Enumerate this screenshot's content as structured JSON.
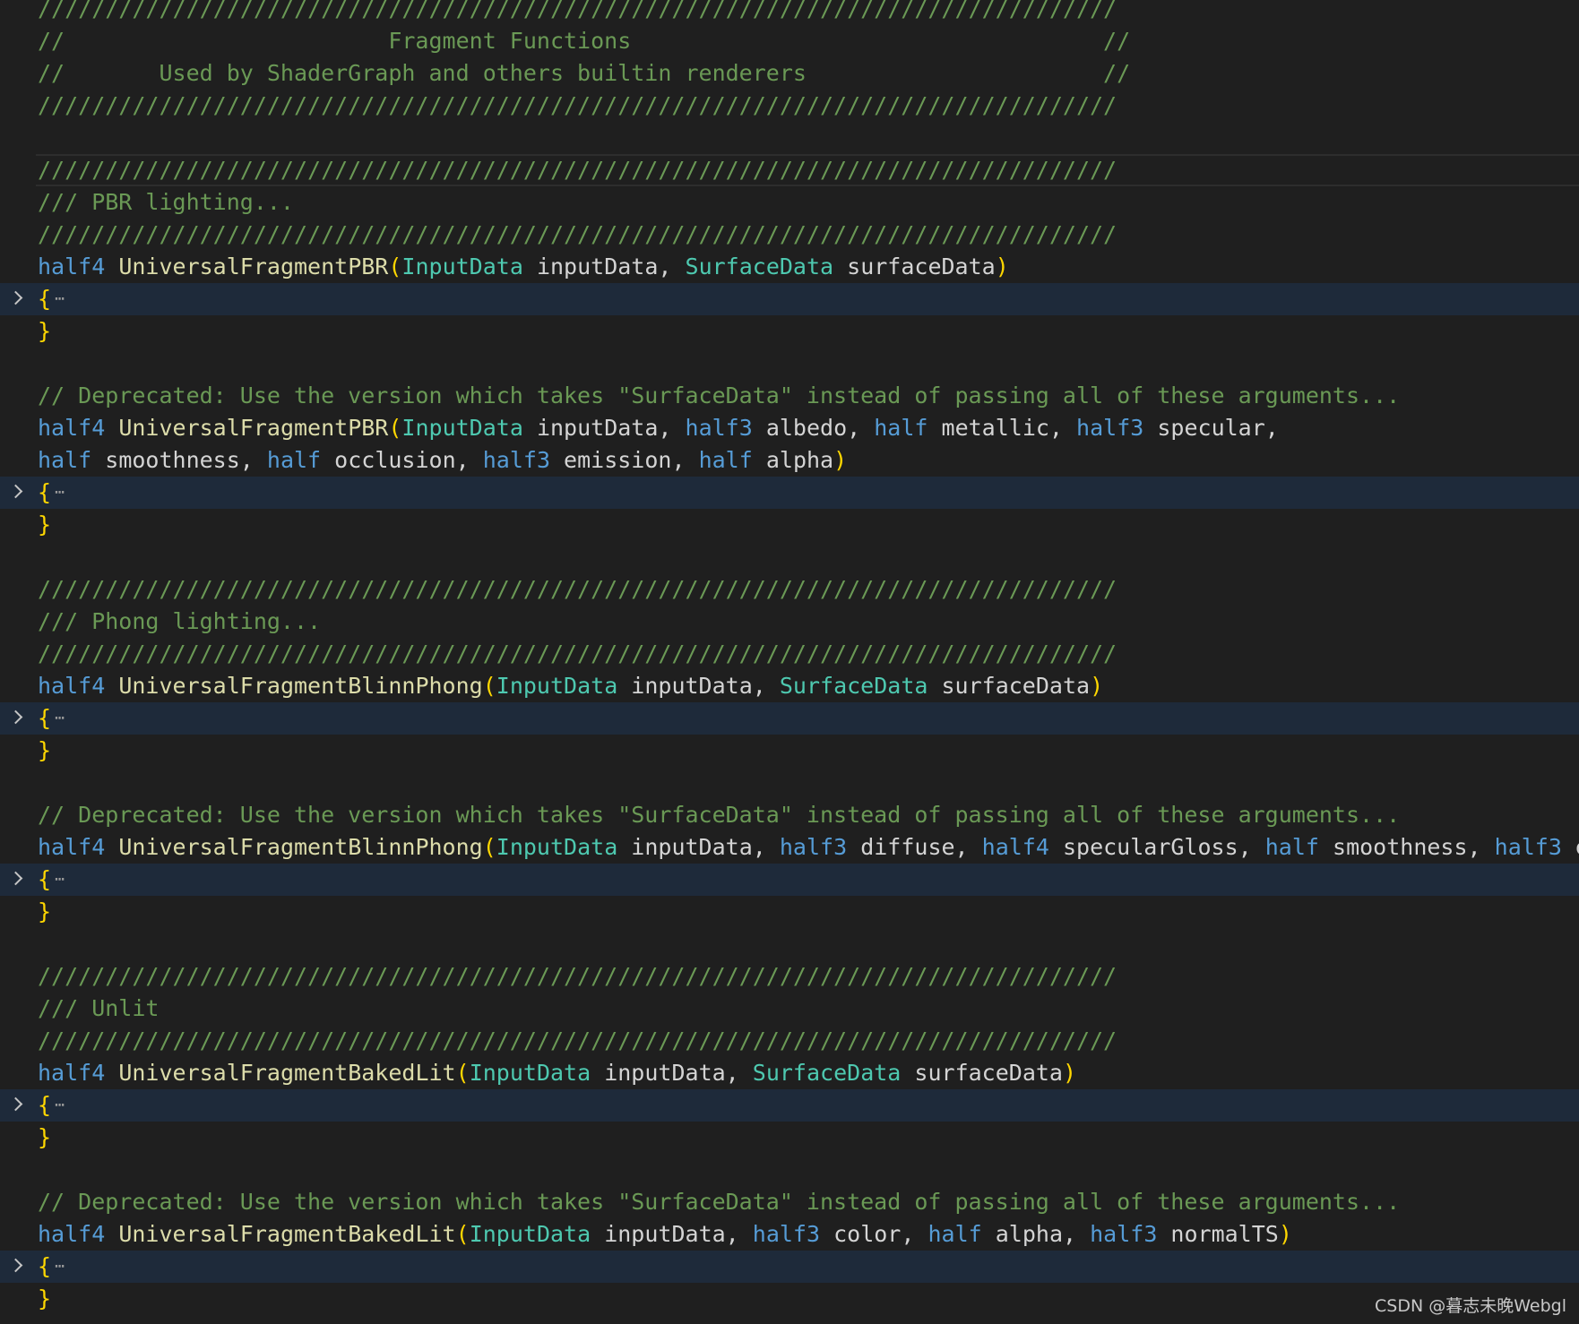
{
  "editor": {
    "lines": [
      {
        "segments": [
          {
            "t": "////////////////////////////////////////////////////////////////////////////////",
            "c": "cm"
          }
        ]
      },
      {
        "segments": [
          {
            "t": "//                        Fragment Functions                                   //",
            "c": "cm"
          }
        ]
      },
      {
        "segments": [
          {
            "t": "//       Used by ShaderGraph and others builtin renderers                      //",
            "c": "cm"
          }
        ]
      },
      {
        "segments": [
          {
            "t": "////////////////////////////////////////////////////////////////////////////////",
            "c": "cm"
          }
        ]
      },
      {
        "segments": []
      },
      {
        "current": true,
        "segments": [
          {
            "t": "////////////////////////////////////////////////////////////////////////////////",
            "c": "cm"
          }
        ]
      },
      {
        "segments": [
          {
            "t": "/// PBR lighting...",
            "c": "cm"
          }
        ]
      },
      {
        "segments": [
          {
            "t": "////////////////////////////////////////////////////////////////////////////////",
            "c": "cm"
          }
        ]
      },
      {
        "segments": [
          {
            "t": "half4",
            "c": "kw"
          },
          {
            "t": " ",
            "c": "id"
          },
          {
            "t": "UniversalFragmentPBR",
            "c": "fn"
          },
          {
            "t": "(",
            "c": "br"
          },
          {
            "t": "InputData",
            "c": "ty"
          },
          {
            "t": " inputData, ",
            "c": "id"
          },
          {
            "t": "SurfaceData",
            "c": "ty"
          },
          {
            "t": " surfaceData",
            "c": "id"
          },
          {
            "t": ")",
            "c": "br"
          }
        ]
      },
      {
        "folded": true,
        "segments": [
          {
            "t": "{",
            "c": "br"
          }
        ]
      },
      {
        "segments": [
          {
            "t": "}",
            "c": "br"
          }
        ]
      },
      {
        "segments": []
      },
      {
        "segments": [
          {
            "t": "// Deprecated: Use the version which takes \"SurfaceData\" instead of passing all of these arguments...",
            "c": "cm"
          }
        ]
      },
      {
        "segments": [
          {
            "t": "half4",
            "c": "kw"
          },
          {
            "t": " ",
            "c": "id"
          },
          {
            "t": "UniversalFragmentPBR",
            "c": "fn"
          },
          {
            "t": "(",
            "c": "br"
          },
          {
            "t": "InputData",
            "c": "ty"
          },
          {
            "t": " inputData, ",
            "c": "id"
          },
          {
            "t": "half3",
            "c": "kw"
          },
          {
            "t": " albedo, ",
            "c": "id"
          },
          {
            "t": "half",
            "c": "kw"
          },
          {
            "t": " metallic, ",
            "c": "id"
          },
          {
            "t": "half3",
            "c": "kw"
          },
          {
            "t": " specular,",
            "c": "id"
          }
        ]
      },
      {
        "segments": [
          {
            "t": "half",
            "c": "kw"
          },
          {
            "t": " smoothness, ",
            "c": "id"
          },
          {
            "t": "half",
            "c": "kw"
          },
          {
            "t": " occlusion, ",
            "c": "id"
          },
          {
            "t": "half3",
            "c": "kw"
          },
          {
            "t": " emission, ",
            "c": "id"
          },
          {
            "t": "half",
            "c": "kw"
          },
          {
            "t": " alpha",
            "c": "id"
          },
          {
            "t": ")",
            "c": "br"
          }
        ]
      },
      {
        "folded": true,
        "segments": [
          {
            "t": "{",
            "c": "br"
          }
        ]
      },
      {
        "segments": [
          {
            "t": "}",
            "c": "br"
          }
        ]
      },
      {
        "segments": []
      },
      {
        "segments": [
          {
            "t": "////////////////////////////////////////////////////////////////////////////////",
            "c": "cm"
          }
        ]
      },
      {
        "segments": [
          {
            "t": "/// Phong lighting...",
            "c": "cm"
          }
        ]
      },
      {
        "segments": [
          {
            "t": "////////////////////////////////////////////////////////////////////////////////",
            "c": "cm"
          }
        ]
      },
      {
        "segments": [
          {
            "t": "half4",
            "c": "kw"
          },
          {
            "t": " ",
            "c": "id"
          },
          {
            "t": "UniversalFragmentBlinnPhong",
            "c": "fn"
          },
          {
            "t": "(",
            "c": "br"
          },
          {
            "t": "InputData",
            "c": "ty"
          },
          {
            "t": " inputData, ",
            "c": "id"
          },
          {
            "t": "SurfaceData",
            "c": "ty"
          },
          {
            "t": " surfaceData",
            "c": "id"
          },
          {
            "t": ")",
            "c": "br"
          }
        ]
      },
      {
        "folded": true,
        "segments": [
          {
            "t": "{",
            "c": "br"
          }
        ]
      },
      {
        "segments": [
          {
            "t": "}",
            "c": "br"
          }
        ]
      },
      {
        "segments": []
      },
      {
        "segments": [
          {
            "t": "// Deprecated: Use the version which takes \"SurfaceData\" instead of passing all of these arguments...",
            "c": "cm"
          }
        ]
      },
      {
        "segments": [
          {
            "t": "half4",
            "c": "kw"
          },
          {
            "t": " ",
            "c": "id"
          },
          {
            "t": "UniversalFragmentBlinnPhong",
            "c": "fn"
          },
          {
            "t": "(",
            "c": "br"
          },
          {
            "t": "InputData",
            "c": "ty"
          },
          {
            "t": " inputData, ",
            "c": "id"
          },
          {
            "t": "half3",
            "c": "kw"
          },
          {
            "t": " diffuse, ",
            "c": "id"
          },
          {
            "t": "half4",
            "c": "kw"
          },
          {
            "t": " specularGloss, ",
            "c": "id"
          },
          {
            "t": "half",
            "c": "kw"
          },
          {
            "t": " smoothness, ",
            "c": "id"
          },
          {
            "t": "half3",
            "c": "kw"
          },
          {
            "t": " emiss",
            "c": "id"
          }
        ]
      },
      {
        "folded": true,
        "segments": [
          {
            "t": "{",
            "c": "br"
          }
        ]
      },
      {
        "segments": [
          {
            "t": "}",
            "c": "br"
          }
        ]
      },
      {
        "segments": []
      },
      {
        "segments": [
          {
            "t": "////////////////////////////////////////////////////////////////////////////////",
            "c": "cm"
          }
        ]
      },
      {
        "segments": [
          {
            "t": "/// Unlit",
            "c": "cm"
          }
        ]
      },
      {
        "segments": [
          {
            "t": "////////////////////////////////////////////////////////////////////////////////",
            "c": "cm"
          }
        ]
      },
      {
        "segments": [
          {
            "t": "half4",
            "c": "kw"
          },
          {
            "t": " ",
            "c": "id"
          },
          {
            "t": "UniversalFragmentBakedLit",
            "c": "fn"
          },
          {
            "t": "(",
            "c": "br"
          },
          {
            "t": "InputData",
            "c": "ty"
          },
          {
            "t": " inputData, ",
            "c": "id"
          },
          {
            "t": "SurfaceData",
            "c": "ty"
          },
          {
            "t": " surfaceData",
            "c": "id"
          },
          {
            "t": ")",
            "c": "br"
          }
        ]
      },
      {
        "folded": true,
        "segments": [
          {
            "t": "{",
            "c": "br"
          }
        ]
      },
      {
        "segments": [
          {
            "t": "}",
            "c": "br"
          }
        ]
      },
      {
        "segments": []
      },
      {
        "segments": [
          {
            "t": "// Deprecated: Use the version which takes \"SurfaceData\" instead of passing all of these arguments...",
            "c": "cm"
          }
        ]
      },
      {
        "segments": [
          {
            "t": "half4",
            "c": "kw"
          },
          {
            "t": " ",
            "c": "id"
          },
          {
            "t": "UniversalFragmentBakedLit",
            "c": "fn"
          },
          {
            "t": "(",
            "c": "br"
          },
          {
            "t": "InputData",
            "c": "ty"
          },
          {
            "t": " inputData, ",
            "c": "id"
          },
          {
            "t": "half3",
            "c": "kw"
          },
          {
            "t": " color, ",
            "c": "id"
          },
          {
            "t": "half",
            "c": "kw"
          },
          {
            "t": " alpha, ",
            "c": "id"
          },
          {
            "t": "half3",
            "c": "kw"
          },
          {
            "t": " normalTS",
            "c": "id"
          },
          {
            "t": ")",
            "c": "br"
          }
        ]
      },
      {
        "folded": true,
        "segments": [
          {
            "t": "{",
            "c": "br"
          }
        ]
      },
      {
        "segments": [
          {
            "t": "}",
            "c": "br"
          }
        ]
      }
    ]
  },
  "folded_marker": "⋯",
  "watermark": "CSDN @暮志未晚Webgl",
  "colors": {
    "background": "#1f1f1f",
    "comment": "#6a9955",
    "keyword": "#569cd6",
    "function": "#dcdcaa",
    "type": "#4ec9b0",
    "bracket": "#ffd700",
    "identifier": "#d4d4d4",
    "folded_line_bg": "#1e2a3a"
  }
}
